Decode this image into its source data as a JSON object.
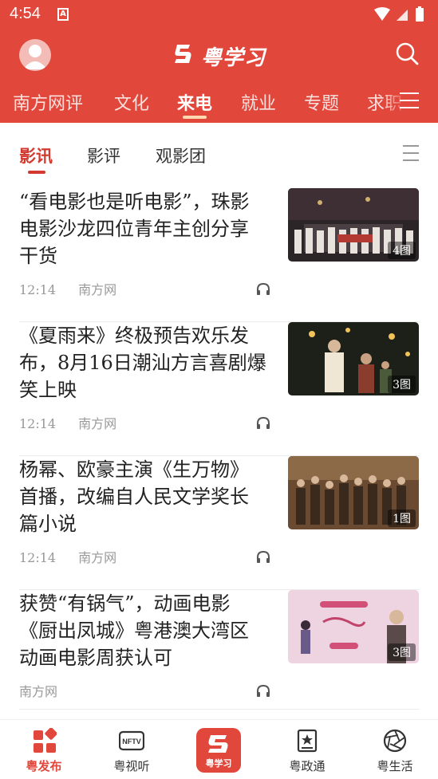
{
  "status_bar": {
    "time": "4:54",
    "notification_icon": "A"
  },
  "header": {
    "brand_name": "粤学习",
    "avatar_icon": "user-avatar-icon",
    "search_icon": "search-icon",
    "accent_color": "#e2473c"
  },
  "channels": {
    "items": [
      "南方网评",
      "文化",
      "来电",
      "就业",
      "专题",
      "求职"
    ],
    "active": "来电",
    "menu_icon": "menu-icon"
  },
  "subtabs": {
    "items": [
      "影讯",
      "影评",
      "观影团"
    ],
    "active": "影讯",
    "menu_icon": "list-icon"
  },
  "articles": [
    {
      "title": "“看电影也是听电影”，珠影电影沙龙四位青年主创分享干货",
      "time": "12:14",
      "source": "南方网",
      "image_count": "4图"
    },
    {
      "title": "《夏雨来》终极预告欢乐发布，8月16日潮汕方言喜剧爆笑上映",
      "time": "12:14",
      "source": "南方网",
      "image_count": "3图"
    },
    {
      "title": "杨幂、欧豪主演《生万物》首播，改编自人民文学奖长篇小说",
      "time": "12:14",
      "source": "南方网",
      "image_count": "1图"
    },
    {
      "title": "获赞“有锅气”，动画电影《厨出凤城》粤港澳大湾区动画电影周获认可",
      "time": "",
      "source": "南方网",
      "image_count": "3图"
    }
  ],
  "tabbar": {
    "items": [
      {
        "label": "粤发布",
        "icon": "grid-icon"
      },
      {
        "label": "粤视听",
        "icon": "tv-icon",
        "icon_text": "NFTV"
      },
      {
        "label": "",
        "icon": "brand-logo-icon",
        "icon_text": "粤学习"
      },
      {
        "label": "粤政通",
        "icon": "star-book-icon"
      },
      {
        "label": "粤生活",
        "icon": "aperture-icon"
      }
    ],
    "active": "粤发布"
  }
}
